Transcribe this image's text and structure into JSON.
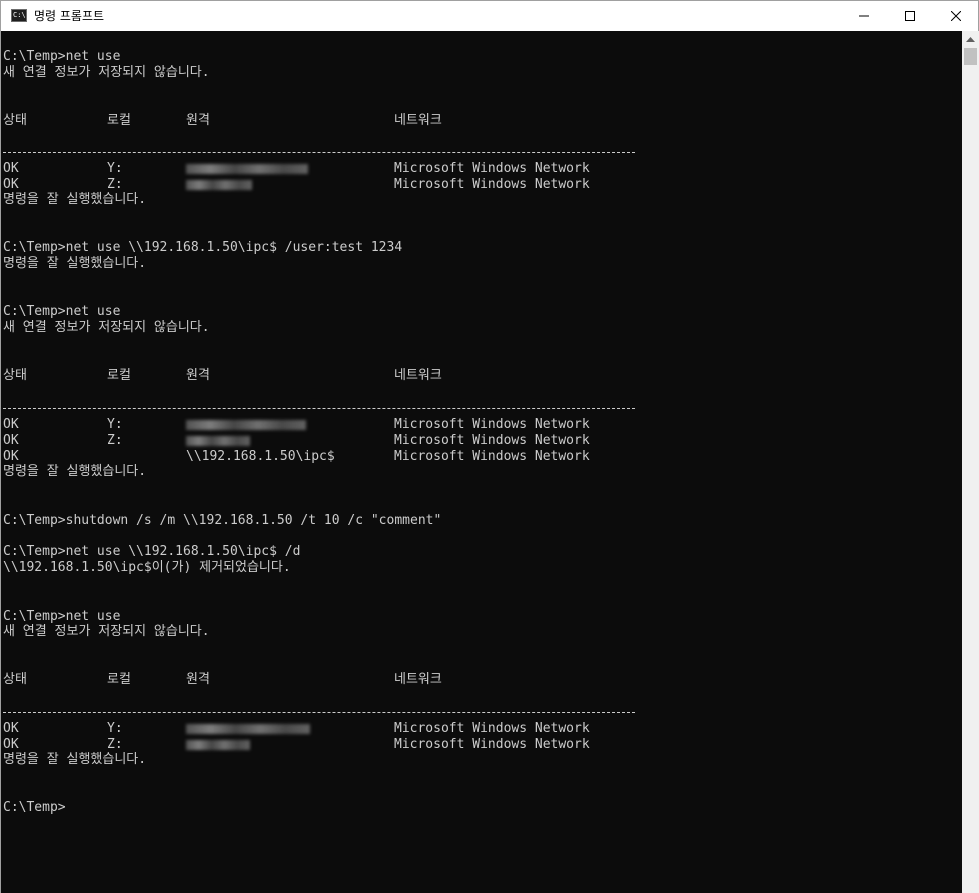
{
  "window": {
    "title": "명령 프롬프트",
    "icon": "cmd-icon",
    "icon_label": "C:\\",
    "buttons": [
      "minimize-icon",
      "maximize-icon",
      "close-icon"
    ]
  },
  "console": {
    "lines": {
      "l0": "C:\\Temp>net use",
      "l1": "새 연결 정보가 저장되지 않습니다.",
      "h1": [
        "상태",
        "로컬",
        "원격",
        "네트워크"
      ],
      "r1": [
        "OK",
        "Y:",
        "",
        "Microsoft Windows Network"
      ],
      "r2": [
        "OK",
        "Z:",
        "",
        "Microsoft Windows Network"
      ],
      "l2": "명령을 잘 실행했습니다.",
      "l3": "C:\\Temp>net use \\\\192.168.1.50\\ipc$ /user:test 1234",
      "l4": "명령을 잘 실행했습니다.",
      "l5": "C:\\Temp>net use",
      "l6": "새 연결 정보가 저장되지 않습니다.",
      "h2": [
        "상태",
        "로컬",
        "원격",
        "네트워크"
      ],
      "r3": [
        "OK",
        "Y:",
        "",
        "Microsoft Windows Network"
      ],
      "r4": [
        "OK",
        "Z:",
        "",
        "Microsoft Windows Network"
      ],
      "r5": [
        "OK",
        "",
        "\\\\192.168.1.50\\ipc$",
        "Microsoft Windows Network"
      ],
      "l7": "명령을 잘 실행했습니다.",
      "l8": "C:\\Temp>shutdown /s /m \\\\192.168.1.50 /t 10 /c \"comment\"",
      "l9": "C:\\Temp>net use \\\\192.168.1.50\\ipc$ /d",
      "l10": "\\\\192.168.1.50\\ipc$이(가) 제거되었습니다.",
      "l11": "C:\\Temp>net use",
      "l12": "새 연결 정보가 저장되지 않습니다.",
      "h3": [
        "상태",
        "로컬",
        "원격",
        "네트워크"
      ],
      "r6": [
        "OK",
        "Y:",
        "",
        "Microsoft Windows Network"
      ],
      "r7": [
        "OK",
        "Z:",
        "",
        "Microsoft Windows Network"
      ],
      "l13": "명령을 잘 실행했습니다.",
      "l14": "C:\\Temp>"
    }
  },
  "colors": {
    "console_bg": "#0c0c0c",
    "console_fg": "#cccccc",
    "titlebar_bg": "#ffffff"
  }
}
